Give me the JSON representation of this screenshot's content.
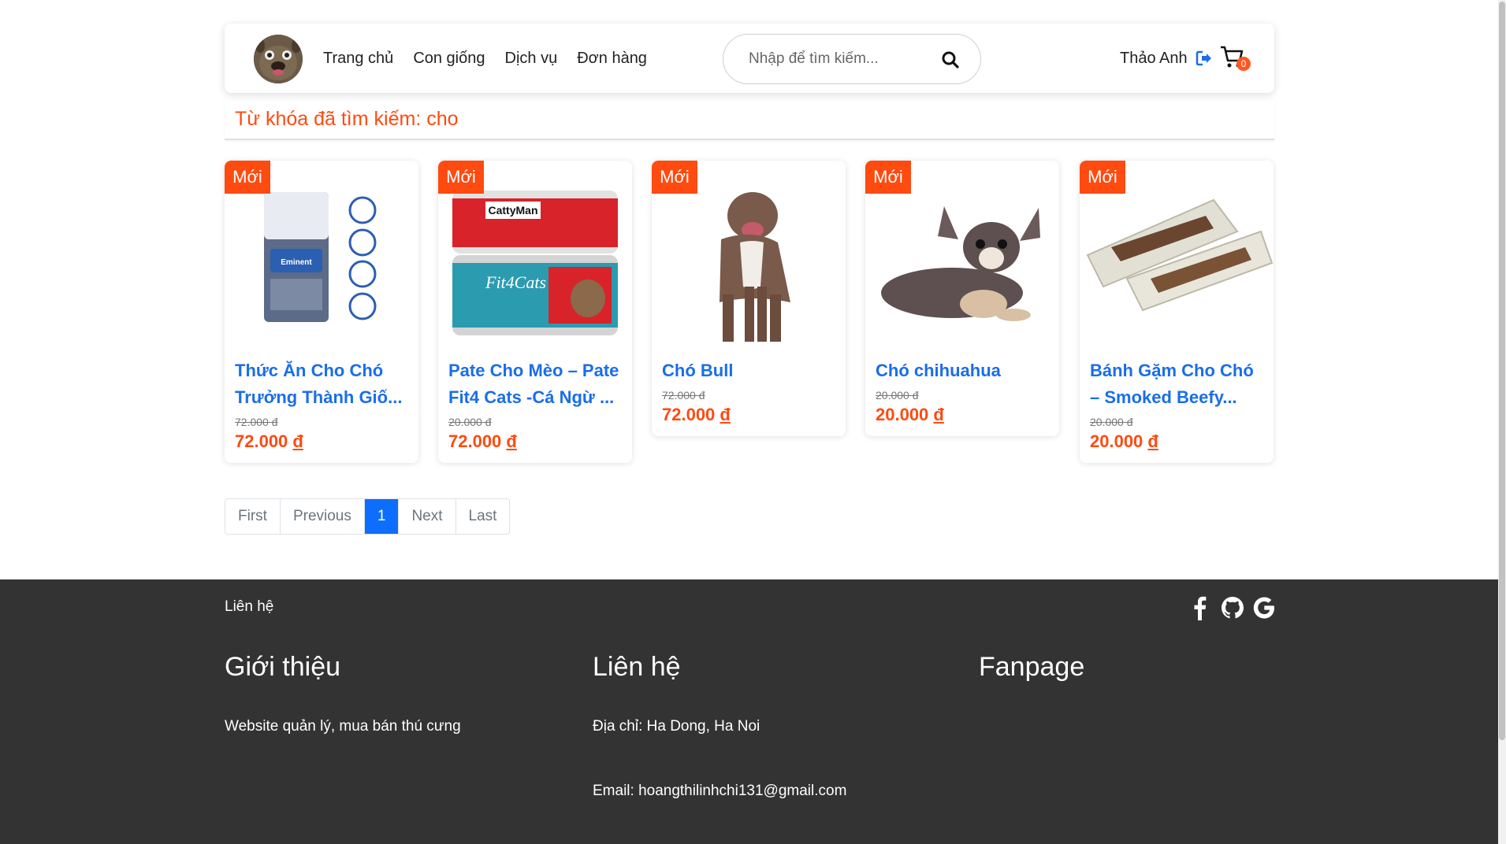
{
  "nav": {
    "items": [
      "Trang chủ",
      "Con giống",
      "Dịch vụ",
      "Đơn hàng"
    ]
  },
  "search": {
    "placeholder": "Nhập để tìm kiếm..."
  },
  "user": {
    "name": "Thảo Anh",
    "cart_count": "0"
  },
  "keyword_bar": {
    "text": "Từ khóa đã tìm kiếm: cho"
  },
  "products": [
    {
      "tag": "Mới",
      "title": "Thức Ăn Cho Chó Trưởng Thành Giố...",
      "old_price": "72.000 đ",
      "price_value": "72.000",
      "currency": "đ",
      "image": "dog-food-bag"
    },
    {
      "tag": "Mới",
      "title": "Pate Cho Mèo – Pate Fit4 Cats -Cá Ngừ ...",
      "old_price": "20.000 đ",
      "price_value": "72.000",
      "currency": "đ",
      "image": "cat-food-can"
    },
    {
      "tag": "Mới",
      "title": "Chó Bull",
      "old_price": "72.000 đ",
      "price_value": "72.000",
      "currency": "đ",
      "image": "pitbull-dog"
    },
    {
      "tag": "Mới",
      "title": "Chó chihuahua",
      "old_price": "20.000 đ",
      "price_value": "20.000",
      "currency": "đ",
      "image": "chihuahua-dog"
    },
    {
      "tag": "Mới",
      "title": "Bánh Gặm Cho Chó – Smoked Beefy...",
      "old_price": "20.000 đ",
      "price_value": "20.000",
      "currency": "đ",
      "image": "dog-chew-treat"
    }
  ],
  "pagination": {
    "first": "First",
    "previous": "Previous",
    "current": "1",
    "next": "Next",
    "last": "Last"
  },
  "footer": {
    "contact_top": "Liên hệ",
    "col1_title": "Giới thiệu",
    "col1_text": "Website quản lý, mua bán thú cưng",
    "col2_title": "Liên hệ",
    "col2_address": "Địa chỉ: Ha Dong, Ha Noi",
    "col2_email": "Email: hoangthilinhchi131@gmail.com",
    "col3_title": "Fanpage",
    "social_icons": [
      "facebook-icon",
      "github-icon",
      "google-icon"
    ]
  },
  "colors": {
    "accent": "#ff4a10",
    "link": "#1a6ee8",
    "footer_bg": "#333333",
    "pagination_active": "#0d6efd"
  }
}
